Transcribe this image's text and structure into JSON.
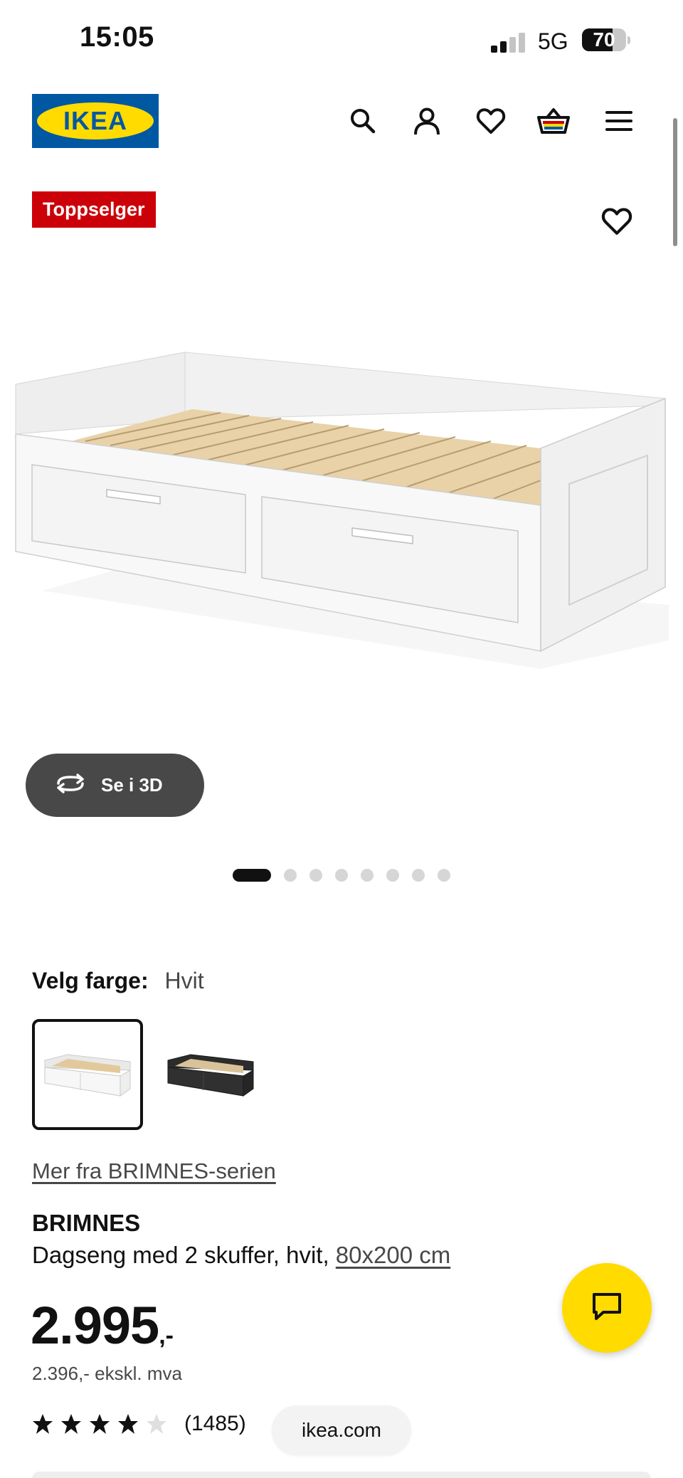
{
  "status_bar": {
    "time": "15:05",
    "network": "5G",
    "battery_level": "70",
    "battery_fraction": 0.7,
    "signal_bars_active": 2,
    "signal_bars_total": 4
  },
  "header": {
    "logo_text": "IKEA",
    "brand_colors": {
      "blue": "#0058a3",
      "yellow": "#ffdb00"
    },
    "icons": [
      "search-icon",
      "account-icon",
      "heart-icon",
      "cart-icon",
      "menu-icon"
    ]
  },
  "product": {
    "badge": "Toppselger",
    "badge_color": "#cc0008",
    "view_3d_label": "Se i 3D",
    "gallery": {
      "total_images": 8,
      "active_index": 0
    },
    "color_label": "Velg farge:",
    "color_value": "Hvit",
    "color_options": [
      {
        "name": "Hvit",
        "selected": true
      },
      {
        "name": "Svart",
        "selected": false
      }
    ],
    "series_link": "Mer fra BRIMNES-serien",
    "name": "BRIMNES",
    "description": "Dagseng med 2 skuffer, hvit, ",
    "size": "80x200 cm",
    "price": "2.995",
    "price_suffix": ",-",
    "price_ex_vat": "2.396,- ekskl. mva",
    "rating": 4,
    "rating_max": 5,
    "review_count": "(1485)"
  },
  "browser": {
    "url": "ikea.com"
  },
  "chat": {
    "icon": "chat-icon"
  }
}
